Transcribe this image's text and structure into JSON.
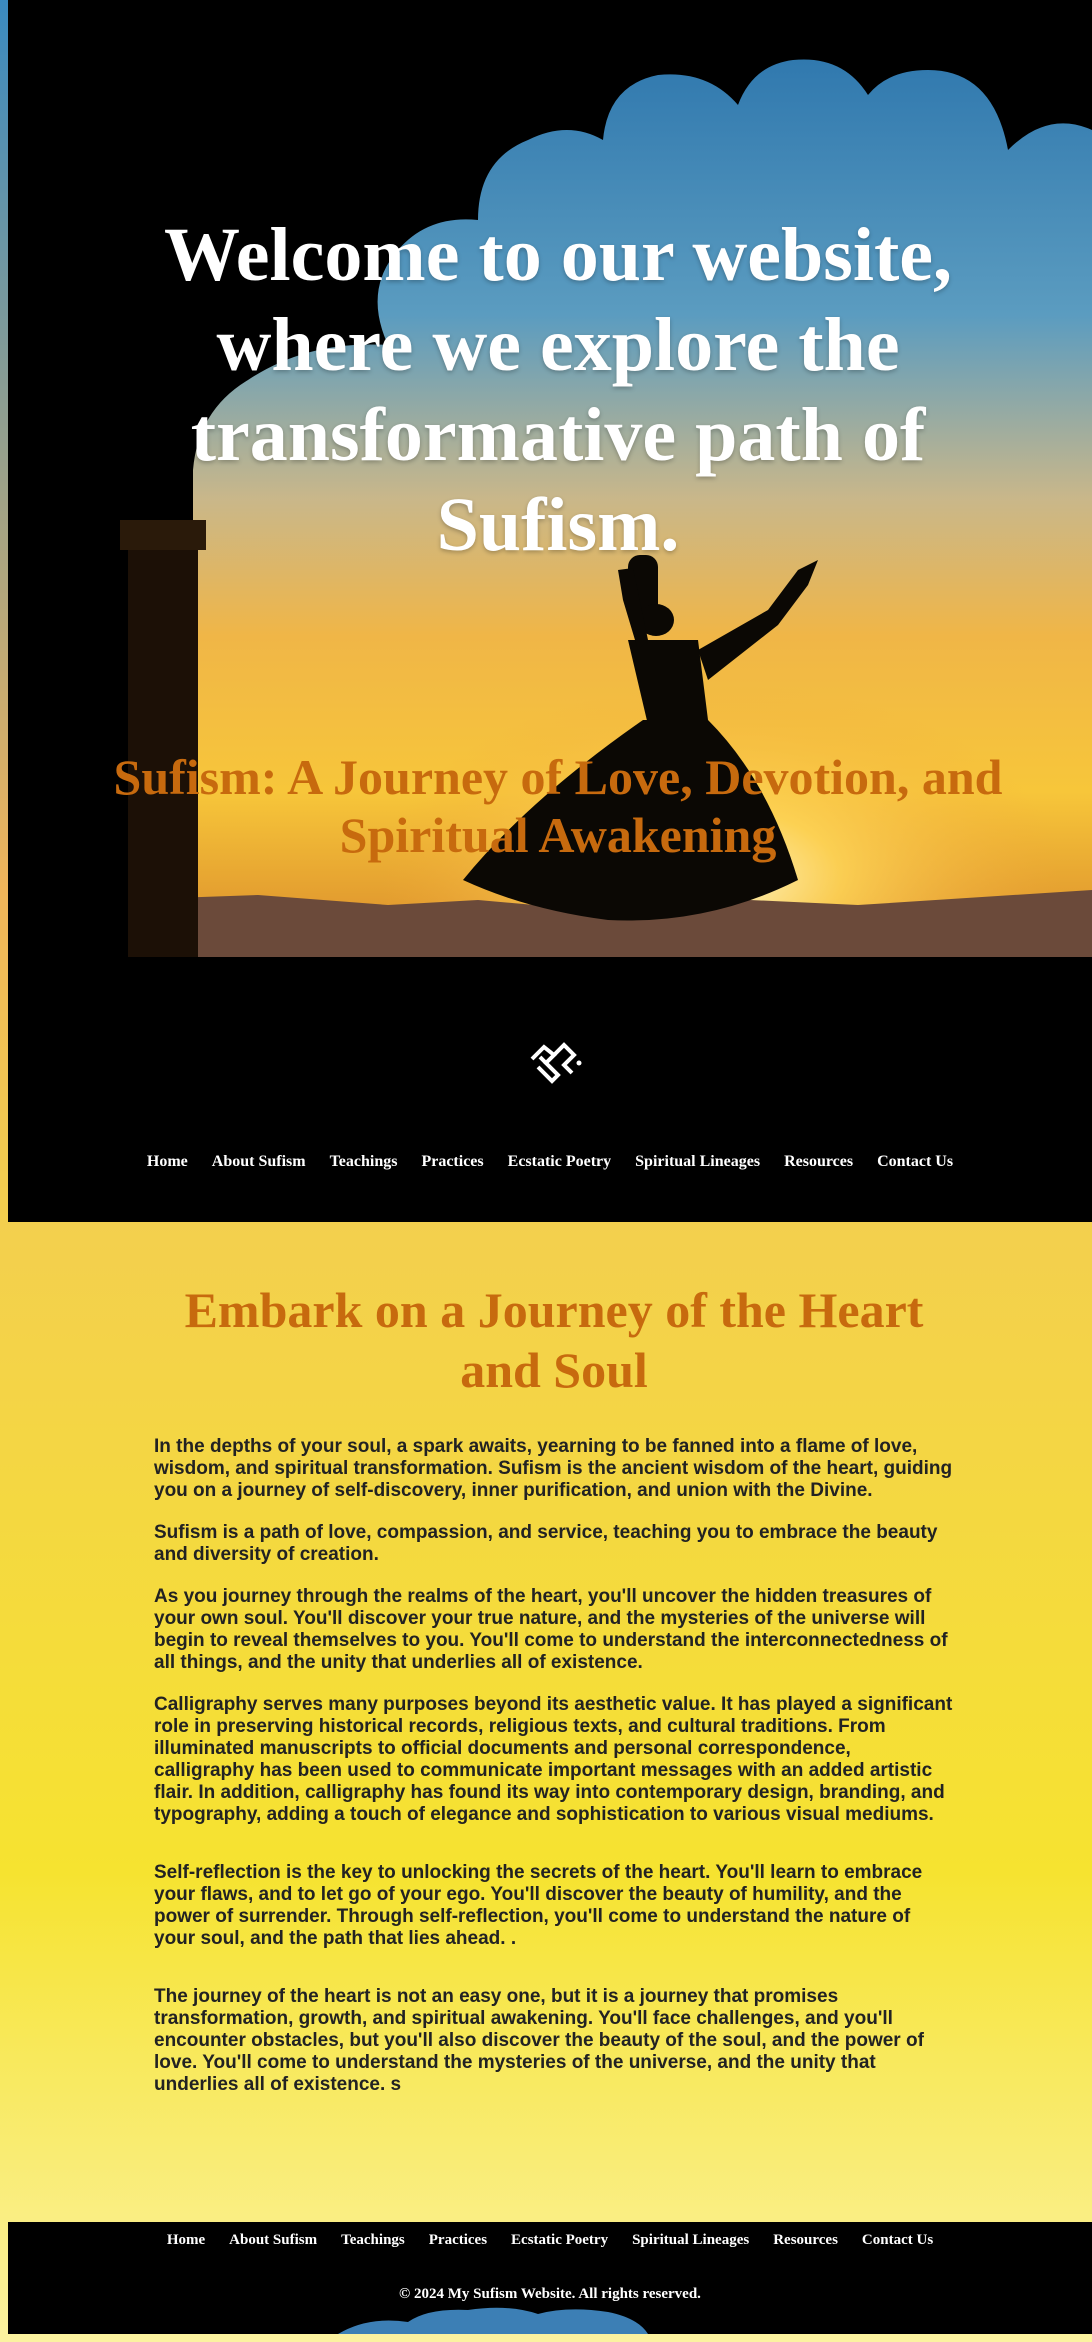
{
  "hero": {
    "title": "Welcome to our website, where we explore the transformative path of Sufism.",
    "subtitle": "Sufism: A Journey of Love, Devotion, and Spiritual Awakening"
  },
  "logo": {
    "icon": "sufi-calligraphy-logo"
  },
  "nav": {
    "items": [
      "Home",
      "About Sufism",
      "Teachings",
      "Practices",
      "Ecstatic Poetry",
      "Spiritual Lineages",
      "Resources",
      "Contact Us"
    ]
  },
  "main": {
    "heading": "Embark on a Journey of the Heart and Soul",
    "paragraphs": [
      "In the depths of your soul, a spark awaits, yearning to be fanned into a flame of love, wisdom, and spiritual transformation. Sufism is the ancient wisdom of the heart, guiding you on a journey of self-discovery, inner purification, and union with the Divine.",
      "Sufism is a path of love, compassion, and service, teaching you to embrace the beauty and diversity of creation.",
      "As you journey through the realms of the heart, you'll uncover the hidden treasures of your own soul. You'll discover your true nature, and the mysteries of the universe will begin to reveal themselves to you. You'll come to understand the interconnectedness of all things, and the unity that underlies all of existence.",
      "Calligraphy serves many purposes beyond its aesthetic value. It has played a significant role in preserving historical records, religious texts, and cultural traditions. From illuminated manuscripts to official documents and personal correspondence, calligraphy has been used to communicate important messages with an added artistic flair. In addition, calligraphy has found its way into contemporary design, branding, and typography, adding a touch of elegance and sophistication to various visual mediums.",
      "Self-reflection is the key to unlocking the secrets of the heart. You'll learn to embrace your flaws, and to let go of your ego. You'll discover the beauty of humility, and the power of surrender. Through self-reflection, you'll come to understand the nature of your soul, and the path that lies ahead. .",
      "The journey of the heart is not an easy one, but it is a journey that promises transformation, growth, and spiritual awakening. You'll face challenges, and you'll encounter obstacles, but you'll also discover the beauty of the soul, and the power of love. You'll come to understand the mysteries of the universe, and the unity that underlies all of existence. s"
    ]
  },
  "footer": {
    "copyright": "© 2024 My Sufism Website. All rights reserved."
  },
  "colors": {
    "accent": "#c76a0e",
    "nav_bg": "#000000",
    "page_gradient_top": "#f0b55a",
    "page_gradient_bottom": "#f6e330"
  }
}
